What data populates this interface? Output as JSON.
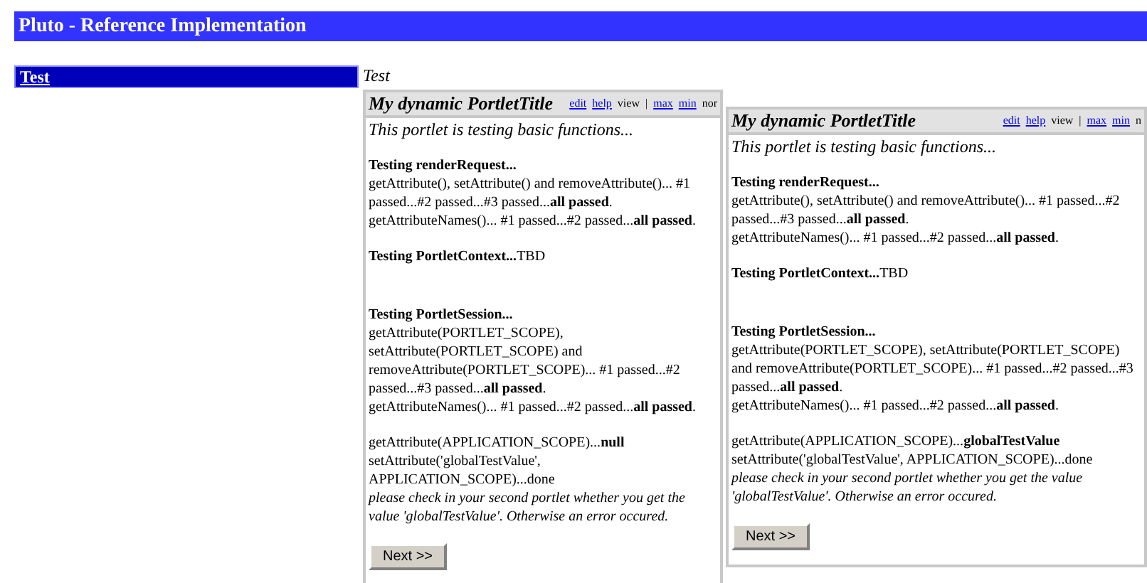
{
  "header": {
    "title": "Pluto - Reference Implementation"
  },
  "sidebar": {
    "items": [
      {
        "label": "Test",
        "selected": true
      }
    ]
  },
  "page_title": "Test",
  "portlets": [
    {
      "title": "My dynamic PortletTitle",
      "links": [
        {
          "label": "edit",
          "kind": "link"
        },
        {
          "label": "help",
          "kind": "link"
        },
        {
          "label": "view",
          "kind": "plain"
        },
        {
          "label": "|",
          "kind": "plain"
        },
        {
          "label": "max",
          "kind": "link"
        },
        {
          "label": "min",
          "kind": "link"
        },
        {
          "label": "nor",
          "kind": "plain"
        }
      ],
      "intro": "This portlet is testing basic functions...",
      "sections": [
        {
          "kind": "normal",
          "lines": [
            {
              "kind": "text",
              "text": "**Testing renderRequest...**"
            },
            {
              "kind": "text",
              "text": "getAttribute(), setAttribute() and removeAttribute()... #1 passed...#2 passed...#3 passed...**all passed**."
            },
            {
              "kind": "text",
              "text": "getAttributeNames()... #1 passed...#2 passed...**all passed**."
            }
          ]
        },
        {
          "kind": "spaced",
          "lines": [
            {
              "kind": "text",
              "text": "**Testing PortletContext...**TBD"
            }
          ]
        },
        {
          "kind": "normal",
          "lines": [
            {
              "kind": "text",
              "text": "**Testing PortletSession...**"
            },
            {
              "kind": "text",
              "text": "getAttribute(PORTLET_SCOPE), setAttribute(PORTLET_SCOPE) and removeAttribute(PORTLET_SCOPE)... #1 passed...#2 passed...#3 passed...**all passed**."
            },
            {
              "kind": "text",
              "text": "getAttributeNames()... #1 passed...#2 passed...**all passed**."
            }
          ]
        },
        {
          "kind": "normal",
          "lines": [
            {
              "kind": "text",
              "text": "getAttribute(APPLICATION_SCOPE)...**null**"
            },
            {
              "kind": "text",
              "text": "setAttribute('globalTestValue', APPLICATION_SCOPE)...done"
            },
            {
              "kind": "note",
              "text": "please check in your second portlet whether you get the value 'globalTestValue'. Otherwise an error occured."
            }
          ]
        }
      ],
      "button": "Next >>"
    },
    {
      "title": "My dynamic PortletTitle",
      "links": [
        {
          "label": "edit",
          "kind": "link"
        },
        {
          "label": "help",
          "kind": "link"
        },
        {
          "label": "view",
          "kind": "plain"
        },
        {
          "label": "|",
          "kind": "plain"
        },
        {
          "label": "max",
          "kind": "link"
        },
        {
          "label": "min",
          "kind": "link"
        },
        {
          "label": "n",
          "kind": "plain"
        }
      ],
      "intro": "This portlet is testing basic functions...",
      "sections": [
        {
          "kind": "normal",
          "lines": [
            {
              "kind": "text",
              "text": "**Testing renderRequest...**"
            },
            {
              "kind": "text",
              "text": "getAttribute(), setAttribute() and removeAttribute()... #1 passed...#2 passed...#3 passed...**all passed**."
            },
            {
              "kind": "text",
              "text": "getAttributeNames()... #1 passed...#2 passed...**all passed**."
            }
          ]
        },
        {
          "kind": "spaced",
          "lines": [
            {
              "kind": "text",
              "text": "**Testing PortletContext...**TBD"
            }
          ]
        },
        {
          "kind": "normal",
          "lines": [
            {
              "kind": "text",
              "text": "**Testing PortletSession...**"
            },
            {
              "kind": "text",
              "text": "getAttribute(PORTLET_SCOPE), setAttribute(PORTLET_SCOPE) and removeAttribute(PORTLET_SCOPE)... #1 passed...#2 passed...#3 passed...**all passed**."
            },
            {
              "kind": "text",
              "text": "getAttributeNames()... #1 passed...#2 passed...**all passed**."
            }
          ]
        },
        {
          "kind": "normal",
          "lines": [
            {
              "kind": "text",
              "text": "getAttribute(APPLICATION_SCOPE)...**globalTestValue**"
            },
            {
              "kind": "text",
              "text": "setAttribute('globalTestValue', APPLICATION_SCOPE)...done"
            },
            {
              "kind": "note",
              "text": "please check in your second portlet whether you get the value 'globalTestValue'. Otherwise an error occured."
            }
          ]
        }
      ],
      "button": "Next >>"
    }
  ]
}
